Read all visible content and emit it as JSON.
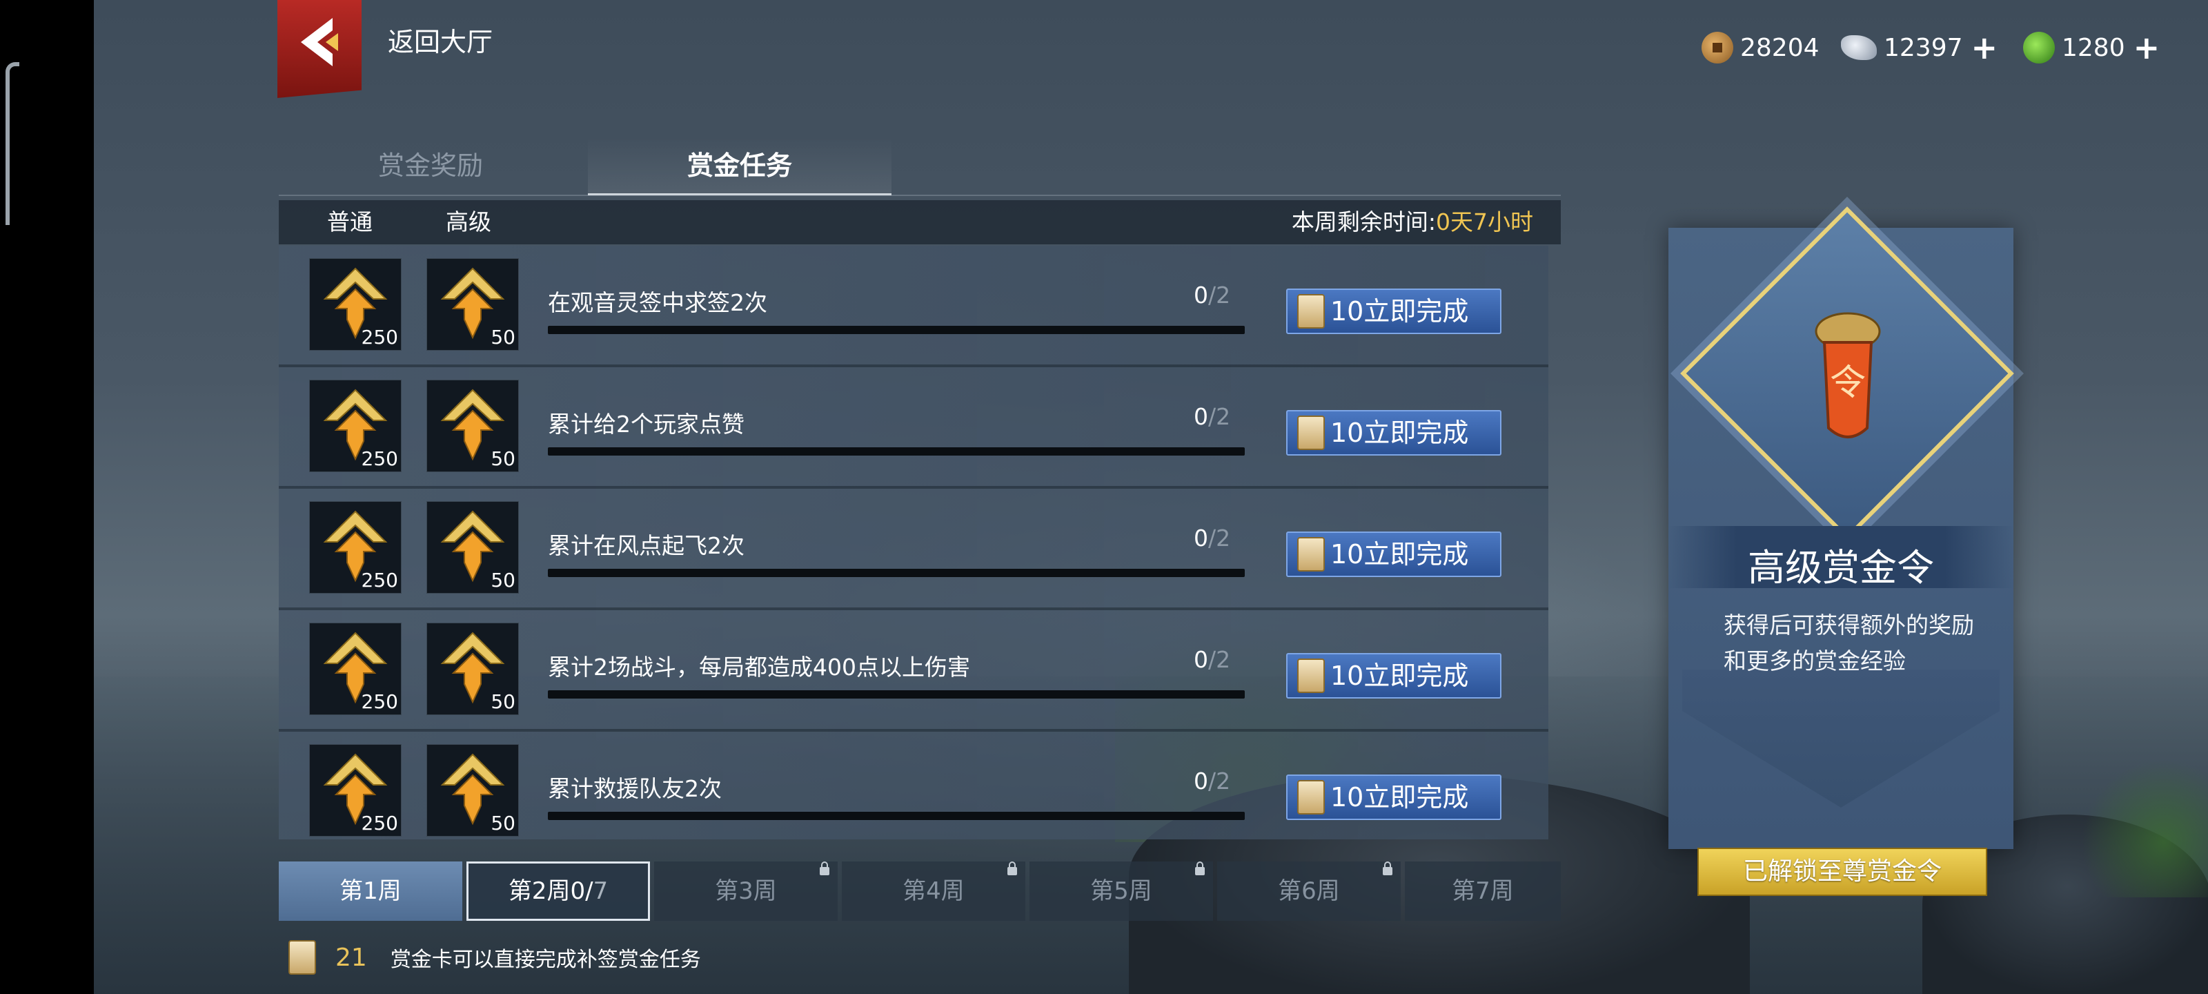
{
  "header": {
    "back_label": "返回大厅",
    "currencies": [
      {
        "icon": "copper-coin-icon",
        "value": "28204",
        "has_plus": false
      },
      {
        "icon": "silver-ingot-icon",
        "value": "12397",
        "has_plus": true
      },
      {
        "icon": "jade-icon",
        "value": "1280",
        "has_plus": true
      }
    ],
    "plus_symbol": "+"
  },
  "tabs": [
    {
      "label": "赏金奖励",
      "active": false
    },
    {
      "label": "赏金任务",
      "active": true
    }
  ],
  "table_header": {
    "normal": "普通",
    "advanced": "高级",
    "time_label": "本周剩余时间:",
    "time_value": "0天7小时"
  },
  "tasks": [
    {
      "desc": "在观音灵签中求签2次",
      "progress": "0",
      "max": "/2",
      "normal_qty": "250",
      "adv_qty": "50",
      "button": "10立即完成"
    },
    {
      "desc": "累计给2个玩家点赞",
      "progress": "0",
      "max": "/2",
      "normal_qty": "250",
      "adv_qty": "50",
      "button": "10立即完成"
    },
    {
      "desc": "累计在风点起飞2次",
      "progress": "0",
      "max": "/2",
      "normal_qty": "250",
      "adv_qty": "50",
      "button": "10立即完成"
    },
    {
      "desc": "累计2场战斗，每局都造成400点以上伤害",
      "progress": "0",
      "max": "/2",
      "normal_qty": "250",
      "adv_qty": "50",
      "button": "10立即完成"
    },
    {
      "desc": "累计救援队友2次",
      "progress": "0",
      "max": "/2",
      "normal_qty": "250",
      "adv_qty": "50",
      "button": "10立即完成"
    }
  ],
  "weeks": [
    {
      "label": "第1周",
      "state": "done"
    },
    {
      "label": "第2周",
      "count": "0/",
      "count_max": "7",
      "state": "current"
    },
    {
      "label": "第3周",
      "state": "locked"
    },
    {
      "label": "第4周",
      "state": "locked"
    },
    {
      "label": "第5周",
      "state": "locked"
    },
    {
      "label": "第6周",
      "state": "locked"
    },
    {
      "label": "第7周",
      "state": "locked"
    }
  ],
  "footer": {
    "count": "21",
    "text": "赏金卡可以直接完成补签赏金任务"
  },
  "panel": {
    "title": "高级赏金令",
    "desc": "获得后可获得额外的奖励和更多的赏金经验",
    "token_glyph": "令",
    "unlock_label": "已解锁至尊赏金令"
  },
  "colors": {
    "accent_gold": "#e8c25a",
    "button_blue": "#3a64ad",
    "back_red": "#b82a25"
  }
}
